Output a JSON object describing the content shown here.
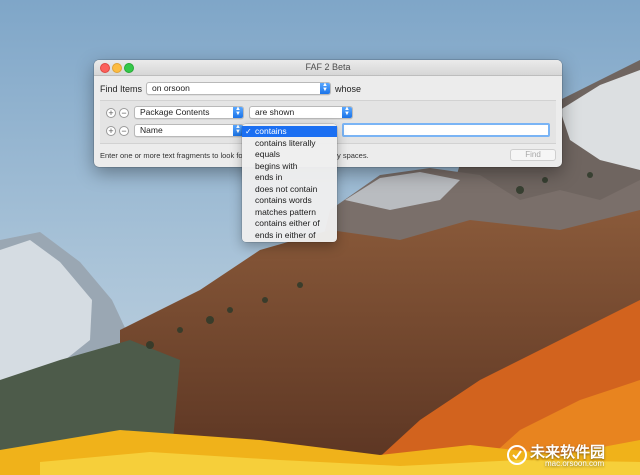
{
  "window": {
    "title": "FAF 2 Beta"
  },
  "search": {
    "find_items_label": "Find Items",
    "location_value": "on orsoon",
    "whose_label": "whose"
  },
  "rules": [
    {
      "attribute": "Package Contents",
      "operator": "are shown"
    },
    {
      "attribute": "Name",
      "operator": "contains",
      "text_value": ""
    }
  ],
  "hint": {
    "text_left": "Enter one or more text fragments to look fo",
    "text_right": "y spaces."
  },
  "find_button": {
    "label": "Find",
    "enabled": false
  },
  "operator_menu": {
    "selected": "contains",
    "items": [
      "contains",
      "contains literally",
      "equals",
      "begins with",
      "ends in",
      "does not contain",
      "contains words",
      "matches pattern",
      "contains either of",
      "ends in either of"
    ]
  },
  "watermark": {
    "title": "未来软件园",
    "url": "mac.orsoon.com"
  },
  "colors": {
    "accent": "#1b6ff2",
    "close": "#fc605b",
    "minimize": "#fdbc40",
    "zoom": "#34c84a"
  }
}
